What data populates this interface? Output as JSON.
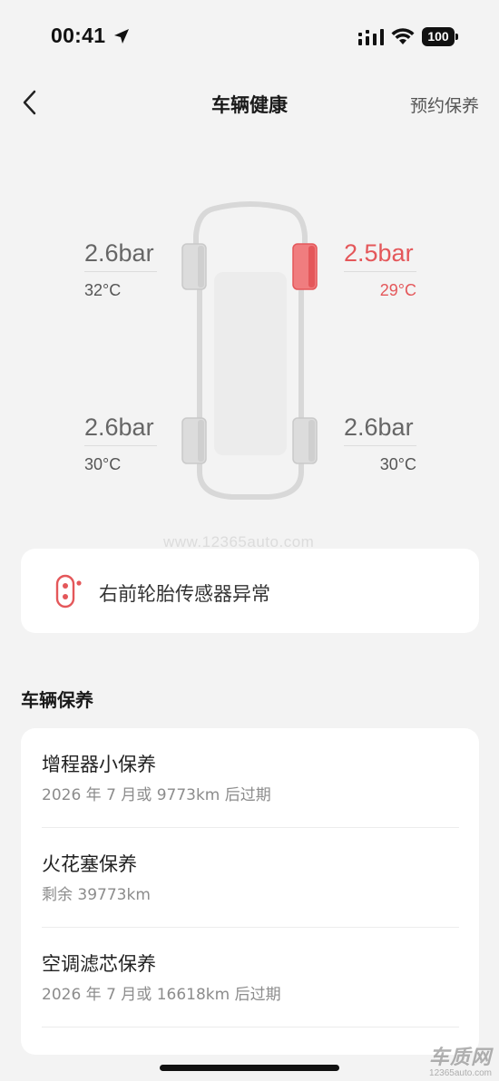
{
  "status_bar": {
    "time": "00:41",
    "battery": "100"
  },
  "nav": {
    "title": "车辆健康",
    "action": "预约保养"
  },
  "tires": {
    "front_left": {
      "pressure": "2.6bar",
      "temp": "32°C",
      "alert": false
    },
    "front_right": {
      "pressure": "2.5bar",
      "temp": "29°C",
      "alert": true
    },
    "rear_left": {
      "pressure": "2.6bar",
      "temp": "30°C",
      "alert": false
    },
    "rear_right": {
      "pressure": "2.6bar",
      "temp": "30°C",
      "alert": false
    }
  },
  "watermark": "www.12365auto.com",
  "alert": {
    "text": "右前轮胎传感器异常"
  },
  "maintenance": {
    "title": "车辆保养",
    "items": [
      {
        "title": "增程器小保养",
        "subtitle": "2026 年 7 月或 9773km 后过期"
      },
      {
        "title": "火花塞保养",
        "subtitle": "剩余 39773km"
      },
      {
        "title": "空调滤芯保养",
        "subtitle": "2026 年 7 月或 16618km 后过期"
      }
    ]
  },
  "logo": {
    "big": "车质网",
    "small": "12365auto.com"
  },
  "colors": {
    "alert": "#e4575a",
    "background": "#f3f3f3",
    "card": "#ffffff"
  }
}
